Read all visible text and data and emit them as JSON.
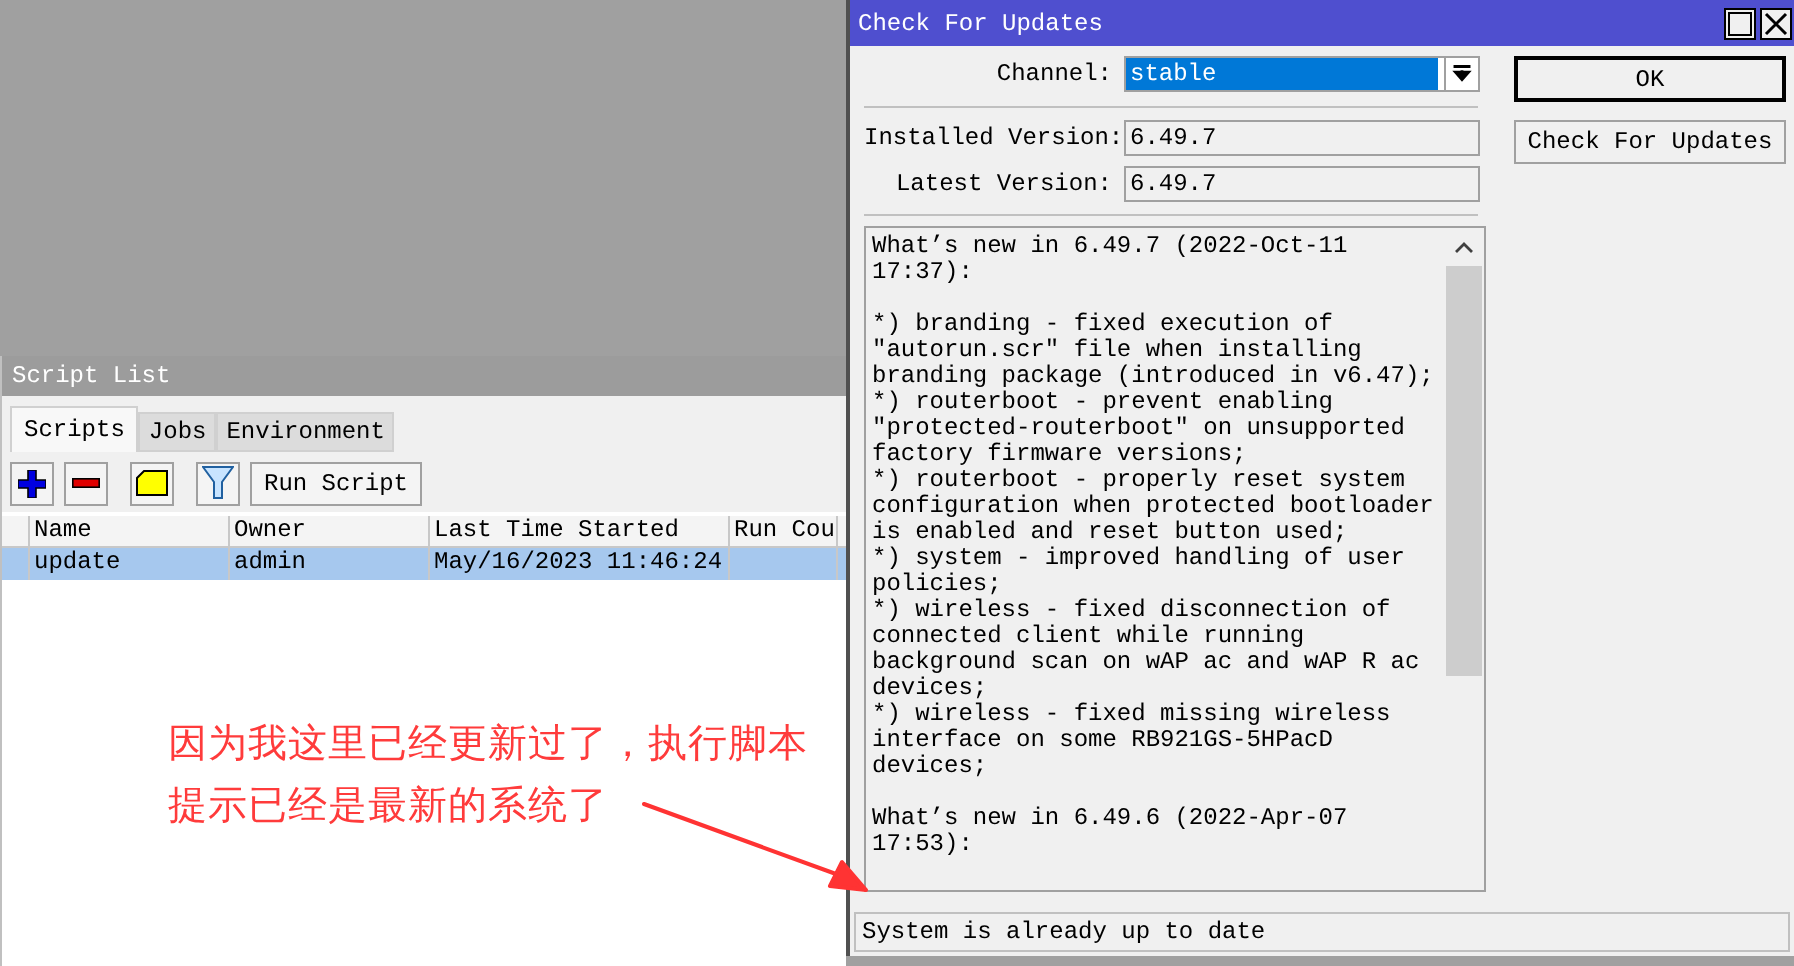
{
  "script_list": {
    "title": "Script List",
    "tabs": [
      {
        "label": "Scripts",
        "selected": true
      },
      {
        "label": "Jobs",
        "selected": false
      },
      {
        "label": "Environment",
        "selected": false
      }
    ],
    "toolbar": {
      "run_button": "Run Script"
    },
    "columns": [
      "Name",
      "Owner",
      "Last Time Started",
      "Run Cou"
    ],
    "rows": [
      {
        "cells": [
          "update",
          "admin",
          "May/16/2023 11:46:24",
          ""
        ],
        "selected": true
      }
    ]
  },
  "annotation": {
    "text": "因为我这里已经更新过了，执行脚本提示已经是最新的系统了"
  },
  "dialog": {
    "title": "Check For Updates",
    "channel": {
      "label": "Channel:",
      "value": "stable"
    },
    "installed": {
      "label": "Installed Version:",
      "value": "6.49.7"
    },
    "latest": {
      "label": "Latest Version:",
      "value": "6.49.7"
    },
    "buttons": [
      "OK",
      "Check For Updates"
    ],
    "notes": [
      [
        "What’s new in 6.49.7 (2022-Oct-11",
        "17:37):"
      ],
      [
        "*) branding - fixed execution of",
        "\"autorun.scr\" file when installing",
        "branding package (introduced in v6.47);",
        "*) routerboot - prevent enabling",
        "\"protected-routerboot\" on unsupported",
        "factory firmware versions;",
        "*) routerboot - properly reset system",
        "configuration when protected bootloader",
        "is enabled and reset button used;",
        "*) system - improved handling of user",
        "policies;",
        "*) wireless - fixed disconnection of",
        "connected client while running",
        "background scan on wAP ac and wAP R ac",
        "devices;",
        "*) wireless - fixed missing wireless",
        "interface on some RB921GS-5HPacD",
        "devices;"
      ],
      [
        "What’s new in 6.49.6 (2022-Apr-07",
        "17:53):"
      ]
    ],
    "status": "System is already up to date"
  }
}
